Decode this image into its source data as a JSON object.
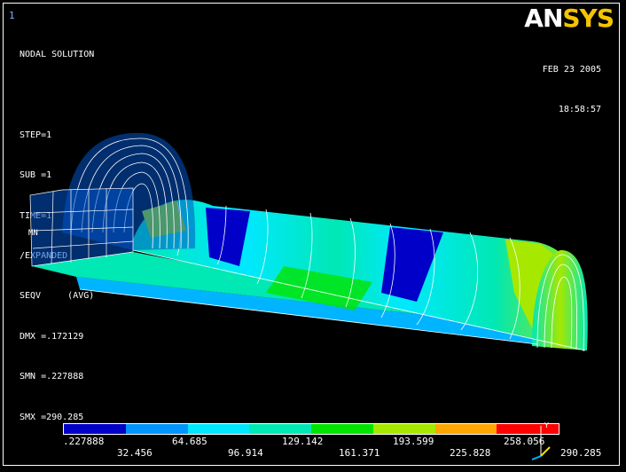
{
  "window_number": "1",
  "logo": {
    "an": "AN",
    "sys": "SYS"
  },
  "info_lines": [
    "NODAL SOLUTION",
    "",
    "STEP=1",
    "SUB =1",
    "TIME=1",
    "/EXPANDED",
    "SEQV     (AVG)",
    "DMX =.172129",
    "SMN =.227888",
    "SMX =290.285"
  ],
  "date": "FEB 23 2005",
  "time": "18:58:57",
  "node_label": "MN",
  "triad_label": "Y",
  "legend": {
    "colors": [
      "#0000c8",
      "#0094ff",
      "#00e8ff",
      "#00e8b4",
      "#00e400",
      "#a6e800",
      "#ffa600",
      "#ff0000"
    ],
    "top_labels": [
      ".227888",
      "64.685",
      "129.142",
      "193.599",
      "258.056"
    ],
    "bottom_labels": [
      "32.456",
      "96.914",
      "161.371",
      "225.828",
      "290.285"
    ]
  }
}
